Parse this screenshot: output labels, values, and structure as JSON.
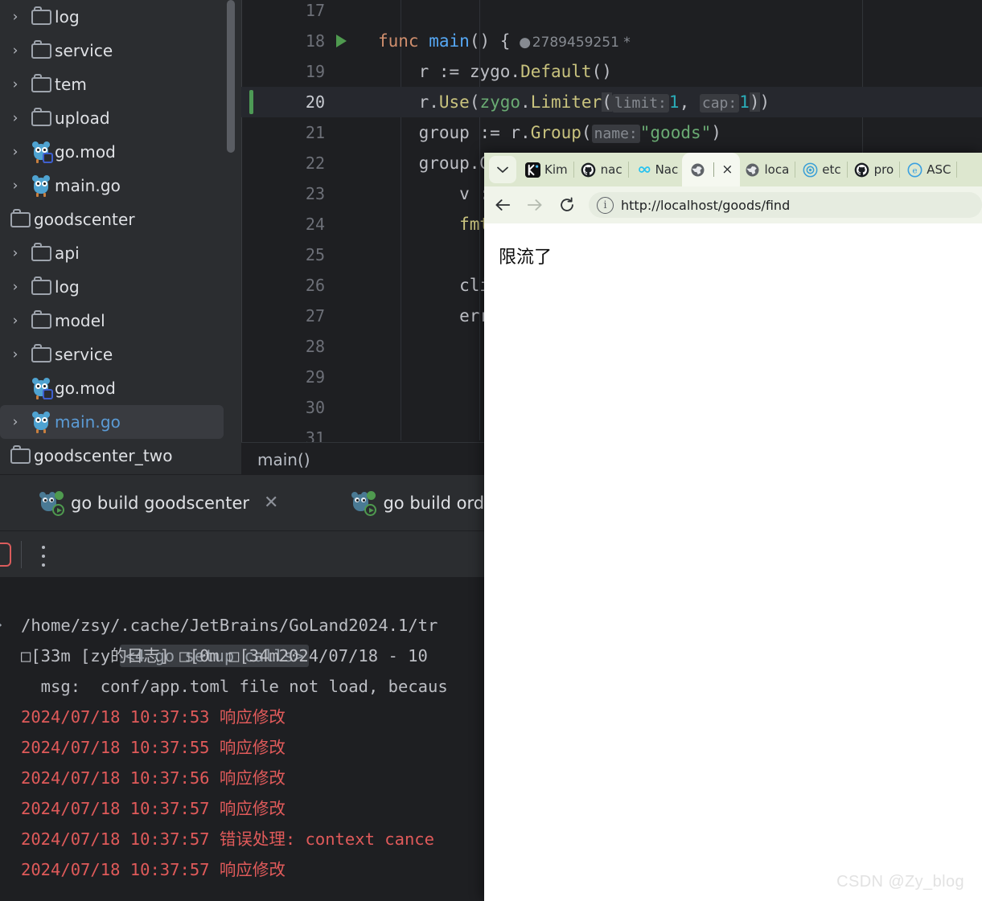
{
  "ide": {
    "project_tree": {
      "items": [
        {
          "label": "log",
          "icon": "folder-icon",
          "chevron": true,
          "indent": 1,
          "selected": false
        },
        {
          "label": "service",
          "icon": "folder-icon",
          "chevron": true,
          "indent": 1,
          "selected": false
        },
        {
          "label": "tem",
          "icon": "folder-icon",
          "chevron": true,
          "indent": 1,
          "selected": false
        },
        {
          "label": "upload",
          "icon": "folder-icon",
          "chevron": true,
          "indent": 1,
          "selected": false
        },
        {
          "label": "go.mod",
          "icon": "go-mod-icon",
          "chevron": true,
          "indent": 1,
          "selected": false
        },
        {
          "label": "main.go",
          "icon": "go-file-icon",
          "chevron": true,
          "indent": 1,
          "selected": false
        },
        {
          "label": "goodscenter",
          "icon": "folder-icon",
          "chevron": false,
          "indent": 0,
          "selected": false
        },
        {
          "label": "api",
          "icon": "folder-icon",
          "chevron": true,
          "indent": 1,
          "selected": false
        },
        {
          "label": "log",
          "icon": "folder-icon",
          "chevron": true,
          "indent": 1,
          "selected": false
        },
        {
          "label": "model",
          "icon": "folder-icon",
          "chevron": true,
          "indent": 1,
          "selected": false
        },
        {
          "label": "service",
          "icon": "folder-icon",
          "chevron": true,
          "indent": 1,
          "selected": false
        },
        {
          "label": "go.mod",
          "icon": "go-mod-icon",
          "chevron": false,
          "indent": 1,
          "selected": false
        },
        {
          "label": "main.go",
          "icon": "go-file-icon",
          "chevron": true,
          "indent": 1,
          "selected": true
        },
        {
          "label": "goodscenter_two",
          "icon": "folder-icon",
          "chevron": false,
          "indent": 0,
          "selected": false
        }
      ]
    },
    "editor": {
      "lines": [
        {
          "num": "17",
          "code": "",
          "run_arrow": false,
          "current": false,
          "changed": false
        },
        {
          "num": "18",
          "code": "func main() {",
          "run_arrow": true,
          "current": false,
          "changed": false,
          "usage": "2789459251 *"
        },
        {
          "num": "19",
          "code": "    r := zygo.Default()",
          "run_arrow": false,
          "current": false,
          "changed": false
        },
        {
          "num": "20",
          "code": "    r.Use(zygo.Limiter( limit: 1,  cap: 1))",
          "run_arrow": false,
          "current": true,
          "changed": true
        },
        {
          "num": "21",
          "code": "    group := r.Group( name: \"goods\")",
          "run_arrow": false,
          "current": false,
          "changed": false
        },
        {
          "num": "22",
          "code": "    group.G",
          "run_arrow": false,
          "current": false,
          "changed": false
        },
        {
          "num": "23",
          "code": "        v :",
          "run_arrow": false,
          "current": false,
          "changed": false
        },
        {
          "num": "24",
          "code": "        fmt",
          "run_arrow": false,
          "current": false,
          "changed": false
        },
        {
          "num": "25",
          "code": "",
          "run_arrow": false,
          "current": false,
          "changed": false
        },
        {
          "num": "26",
          "code": "        cli",
          "run_arrow": false,
          "current": false,
          "changed": false
        },
        {
          "num": "27",
          "code": "        err",
          "run_arrow": false,
          "current": false,
          "changed": false
        },
        {
          "num": "28",
          "code": "",
          "run_arrow": false,
          "current": false,
          "changed": false
        },
        {
          "num": "29",
          "code": "",
          "run_arrow": false,
          "current": false,
          "changed": false
        },
        {
          "num": "30",
          "code": "",
          "run_arrow": false,
          "current": false,
          "changed": false
        },
        {
          "num": "31",
          "code": "",
          "run_arrow": false,
          "current": false,
          "changed": false
        }
      ],
      "tokens_line18": {
        "kw": "func",
        "fn": "main",
        "rest": "() {",
        "usage": "2789459251 *"
      },
      "tokens_line19": {
        "recv": "r",
        "assign": ":=",
        "pkg": "zygo",
        "dot": ".",
        "meth": "Default",
        "paren": "()"
      },
      "tokens_line20": {
        "recv": "r.",
        "meth": "Use",
        "open": "(",
        "pkg": "zygo",
        "meth2": "Limiter",
        "hint1": "limit:",
        "num1": "1",
        "hint2": "cap:",
        "num2": "1",
        "close": "))"
      },
      "tokens_line21": {
        "name": "group",
        "assign": ":=",
        "recv": "r.",
        "meth": "Group",
        "open": "(",
        "hint": "name:",
        "str": "\"goods\"",
        "close": ")"
      },
      "tokens_line22": {
        "text": "group.G"
      },
      "breadcrumb": "main()"
    },
    "run_window": {
      "tabs": [
        {
          "label": "go build goodscenter",
          "closable": true
        },
        {
          "label": "go build ordercente",
          "closable": false
        }
      ],
      "console_lines": [
        {
          "text": "<4 go setup calls>",
          "style": "fold",
          "arrow": "›"
        },
        {
          "text": "/home/zsy/.cache/JetBrains/GoLand2024.1/tr",
          "style": "white"
        },
        {
          "text": "□[33m [zy的日志] □[0m □[34m2024/07/18 - 10",
          "style": "white"
        },
        {
          "text": "  msg:  conf/app.toml file not load, becaus",
          "style": "white"
        },
        {
          "text": "2024/07/18 10:37:53 响应修改",
          "style": "red"
        },
        {
          "text": "2024/07/18 10:37:55 响应修改",
          "style": "red"
        },
        {
          "text": "2024/07/18 10:37:56 响应修改",
          "style": "red"
        },
        {
          "text": "2024/07/18 10:37:57 响应修改",
          "style": "red"
        },
        {
          "text": "2024/07/18 10:37:57 错误处理: context cance",
          "style": "red"
        },
        {
          "text": "2024/07/18 10:37:57 响应修改",
          "style": "red"
        }
      ]
    }
  },
  "browser": {
    "tabs": [
      {
        "label": "Kim",
        "favicon": "kimi-icon",
        "active": false
      },
      {
        "label": "nac",
        "favicon": "github-icon",
        "active": false
      },
      {
        "label": "Nac",
        "favicon": "infinity-icon",
        "active": false
      },
      {
        "label": "",
        "favicon": "globe-icon",
        "active": true
      },
      {
        "label": "loca",
        "favicon": "globe-icon",
        "active": false
      },
      {
        "label": "etc",
        "favicon": "etcd-icon",
        "active": false
      },
      {
        "label": "pro",
        "favicon": "github-icon",
        "active": false
      },
      {
        "label": "ASC",
        "favicon": "euler-icon",
        "active": false
      }
    ],
    "tab_close_label": "×",
    "toolbar": {
      "back_label": "←",
      "forward_label": "→",
      "reload_label": "⟳",
      "info_label": "i"
    },
    "url": "http://localhost/goods/find",
    "page_text": "限流了"
  },
  "watermark": "CSDN @Zy_blog",
  "colors": {
    "ide_bg": "#2b2d30",
    "editor_bg": "#1e1f22",
    "selection": "#393b40",
    "accent_blue": "#5b9bd5",
    "log_red": "#e05a5a",
    "change_green": "#4d9a55",
    "browser_tabstrip": "#dde7cf"
  }
}
